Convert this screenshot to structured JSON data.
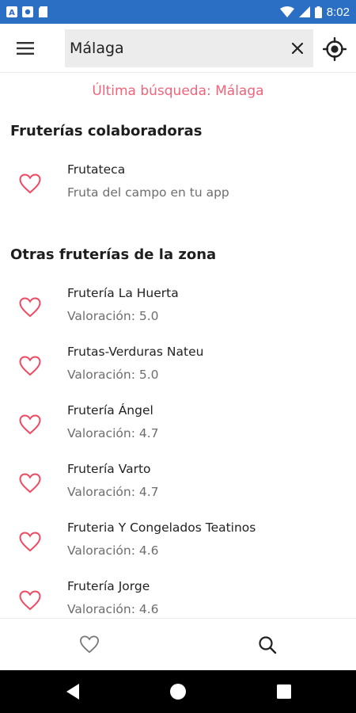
{
  "status_bar": {
    "time": "8:02",
    "left_icons": [
      "notification-a-icon",
      "settings-notification-icon",
      "sd-card-icon"
    ],
    "right_icons": [
      "wifi-icon",
      "signal-icon",
      "battery-icon"
    ]
  },
  "appbar": {
    "menu_icon": "hamburger-menu-icon",
    "search_value": "Málaga",
    "clear_icon": "close-icon",
    "locate_icon": "my-location-icon"
  },
  "last_search": "Última búsqueda: Málaga",
  "sections": {
    "partners": {
      "title": "Fruterías colaboradoras",
      "items": [
        {
          "name": "Frutateca",
          "subtitle": "Fruta del campo en tu app"
        }
      ]
    },
    "others": {
      "title": "Otras fruterías de la zona",
      "items": [
        {
          "name": "Frutería La Huerta",
          "subtitle": "Valoración: 5.0"
        },
        {
          "name": "Frutas-Verduras Nateu",
          "subtitle": "Valoración: 5.0"
        },
        {
          "name": "Frutería Ángel",
          "subtitle": "Valoración: 4.7"
        },
        {
          "name": "Frutería Varto",
          "subtitle": "Valoración: 4.7"
        },
        {
          "name": "Fruteria Y Congelados Teatinos",
          "subtitle": "Valoración: 4.6"
        },
        {
          "name": "Frutería Jorge",
          "subtitle": "Valoración: 4.6"
        }
      ]
    }
  },
  "bottom_nav": {
    "tabs": [
      {
        "icon": "heart-outline-icon"
      },
      {
        "icon": "search-icon"
      }
    ]
  },
  "colors": {
    "status_bar": "#2a6fc4",
    "accent": "#f06479",
    "heart": "#ef4a63",
    "search_bg": "#ececec"
  },
  "system_nav": {
    "buttons": [
      "back-icon",
      "home-icon",
      "recents-icon"
    ]
  }
}
